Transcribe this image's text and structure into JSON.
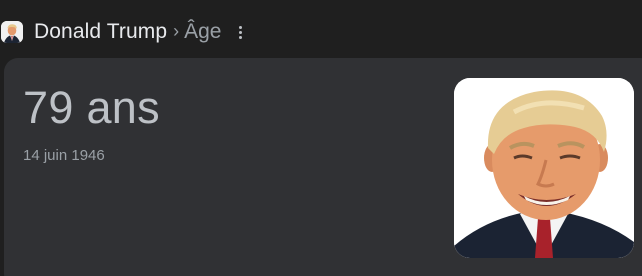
{
  "breadcrumb": {
    "entity": "Donald Trump",
    "separator": "›",
    "attribute": "Âge"
  },
  "answer": {
    "age": "79 ans",
    "birth_date": "14 juin 1946"
  },
  "icons": {
    "menu": "more-vert-icon"
  },
  "colors": {
    "page_background": "#1f1f1f",
    "card_background": "#303134",
    "primary_text": "#e8eaed",
    "secondary_text": "#9aa0a6",
    "age_text": "#bdc1c6"
  }
}
